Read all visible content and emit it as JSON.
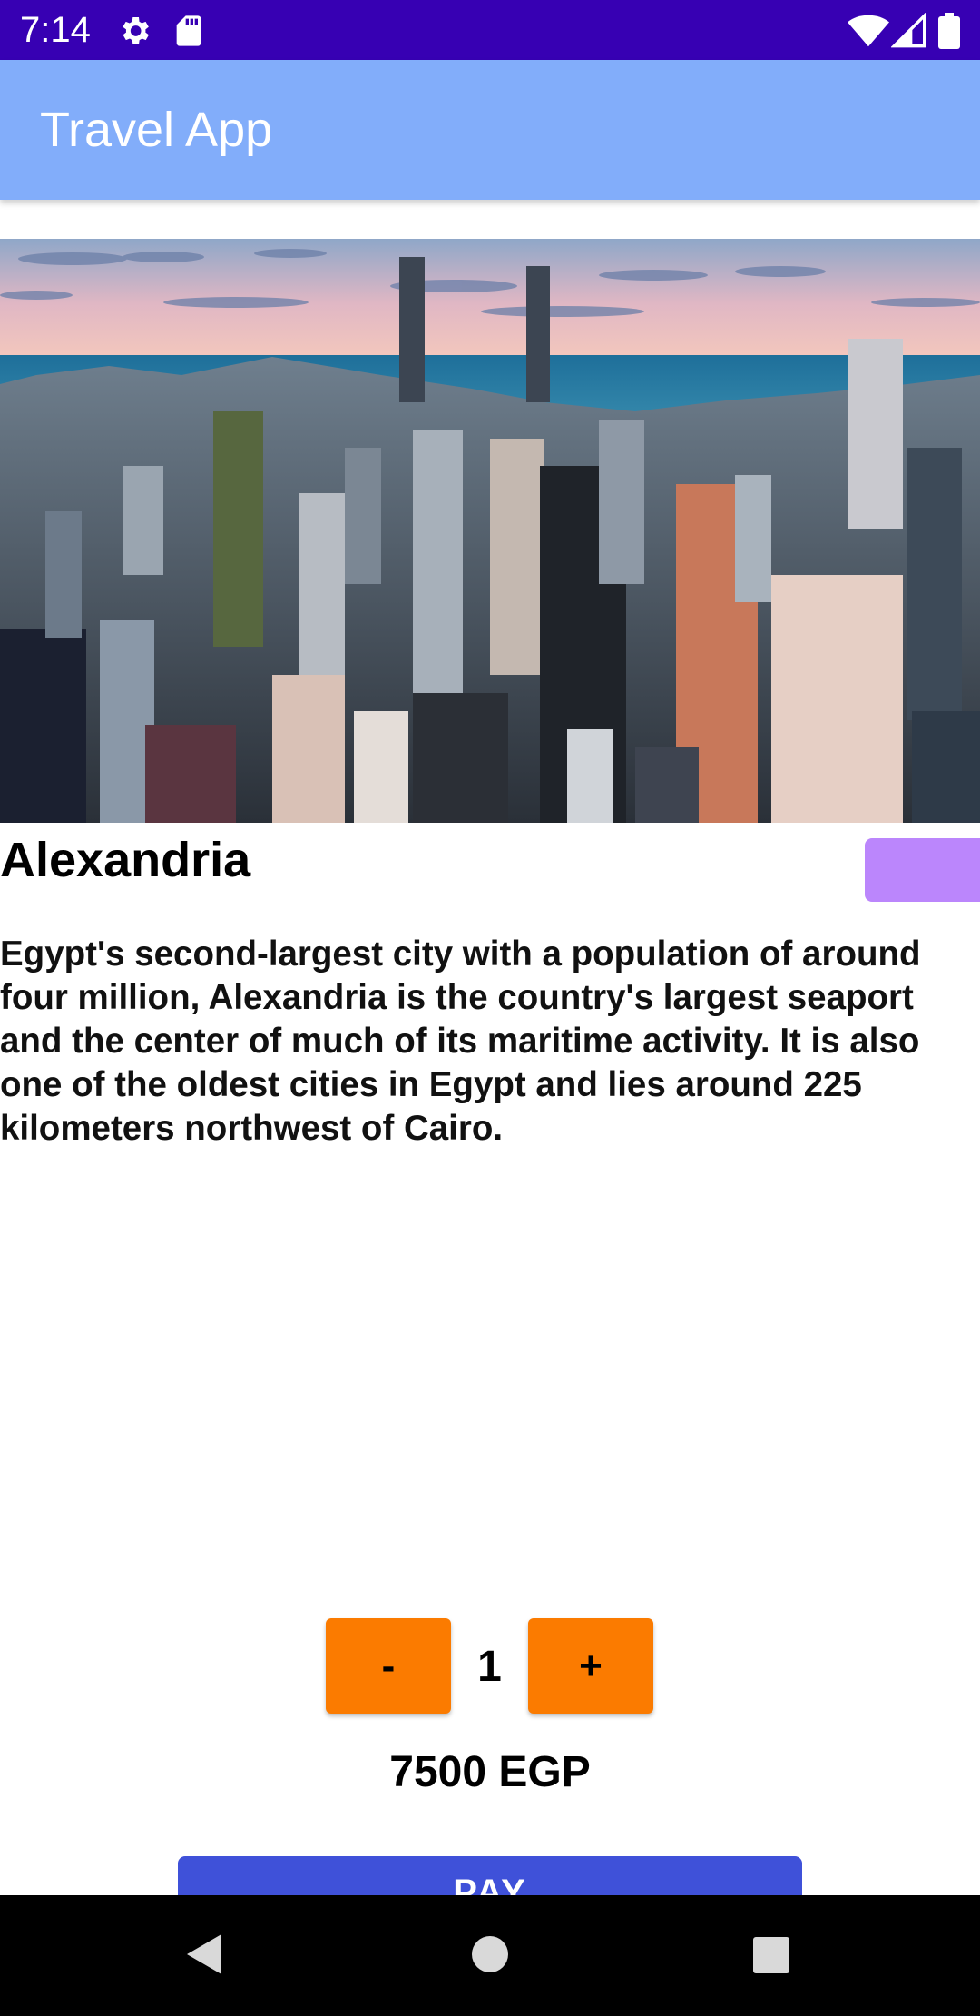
{
  "status_bar": {
    "time": "7:14",
    "left_icons": [
      "gear-icon",
      "sd-card-icon"
    ],
    "right_icons": [
      "wifi-icon",
      "signal-icon",
      "battery-icon"
    ],
    "background": "#3700b3"
  },
  "app_bar": {
    "title": "Travel App",
    "background": "#82adfa"
  },
  "destination": {
    "image": "city-skyline-image",
    "name": "Alexandria",
    "description": "Egypt's second-largest city with a population of around four million, Alexandria is the country's largest seaport and the center of much of its maritime activity. It is also one of the oldest cities in Egypt and lies around 225 kilometers northwest of Cairo.",
    "favorite_button_color": "#bb86fc"
  },
  "booking": {
    "minus_label": "-",
    "quantity": "1",
    "plus_label": "+",
    "price": "7500 EGP",
    "pay_label": "PAY",
    "stepper_color": "#fb7b00",
    "pay_color": "#3f51d9"
  },
  "nav_bar": {
    "icons": [
      "back-icon",
      "home-icon",
      "recents-icon"
    ]
  }
}
